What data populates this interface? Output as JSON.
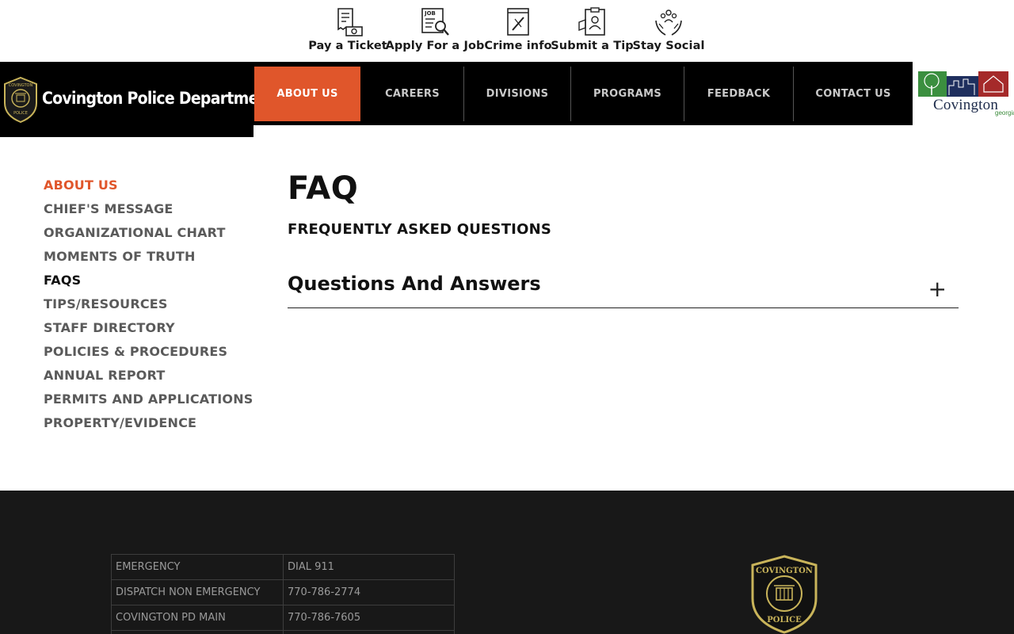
{
  "utility": {
    "items": [
      {
        "label": "Pay a Ticket",
        "icon": "ticket-money-icon"
      },
      {
        "label": "Apply For a Job",
        "icon": "job-search-icon"
      },
      {
        "label": "Crime info",
        "icon": "evidence-bag-icon"
      },
      {
        "label": "Submit a Tip",
        "icon": "clipboard-tip-icon"
      },
      {
        "label": "Stay Social",
        "icon": "hands-people-icon"
      }
    ]
  },
  "header": {
    "brand_name": "Covington Police Department",
    "badge_text_top": "COVINGTON",
    "badge_text_bottom": "POLICE",
    "nav": [
      {
        "label": "ABOUT US",
        "active": true
      },
      {
        "label": "CAREERS"
      },
      {
        "label": "DIVISIONS"
      },
      {
        "label": "PROGRAMS"
      },
      {
        "label": "FEEDBACK"
      },
      {
        "label": "CONTACT US"
      }
    ],
    "city_logo": {
      "name": "Covington",
      "sub": "georgia"
    }
  },
  "sidebar": {
    "items": [
      {
        "label": "ABOUT US"
      },
      {
        "label": "CHIEF'S MESSAGE"
      },
      {
        "label": "ORGANIZATIONAL CHART"
      },
      {
        "label": "MOMENTS OF TRUTH"
      },
      {
        "label": "FAQS"
      },
      {
        "label": "TIPS/RESOURCES"
      },
      {
        "label": "STAFF DIRECTORY"
      },
      {
        "label": "POLICIES & PROCEDURES"
      },
      {
        "label": "ANNUAL REPORT"
      },
      {
        "label": "PERMITS AND APPLICATIONS"
      },
      {
        "label": "PROPERTY/EVIDENCE"
      }
    ]
  },
  "main": {
    "title": "FAQ",
    "subtitle": "FREQUENTLY ASKED QUESTIONS",
    "accordion": {
      "title": "Questions And Answers",
      "toggle": "+"
    }
  },
  "footer": {
    "contacts": [
      {
        "label": "EMERGENCY",
        "value": "DIAL 911"
      },
      {
        "label": "DISPATCH NON EMERGENCY",
        "value": "770-786-2774"
      },
      {
        "label": "COVINGTON PD MAIN",
        "value": "770-786-7605"
      }
    ],
    "badge_text_top": "COVINGTON",
    "badge_text_bottom": "POLICE"
  },
  "colors": {
    "accent": "#e0562b",
    "header_bg": "#000000",
    "footer_bg": "#181818",
    "badge_gold": "#c9b45a"
  }
}
